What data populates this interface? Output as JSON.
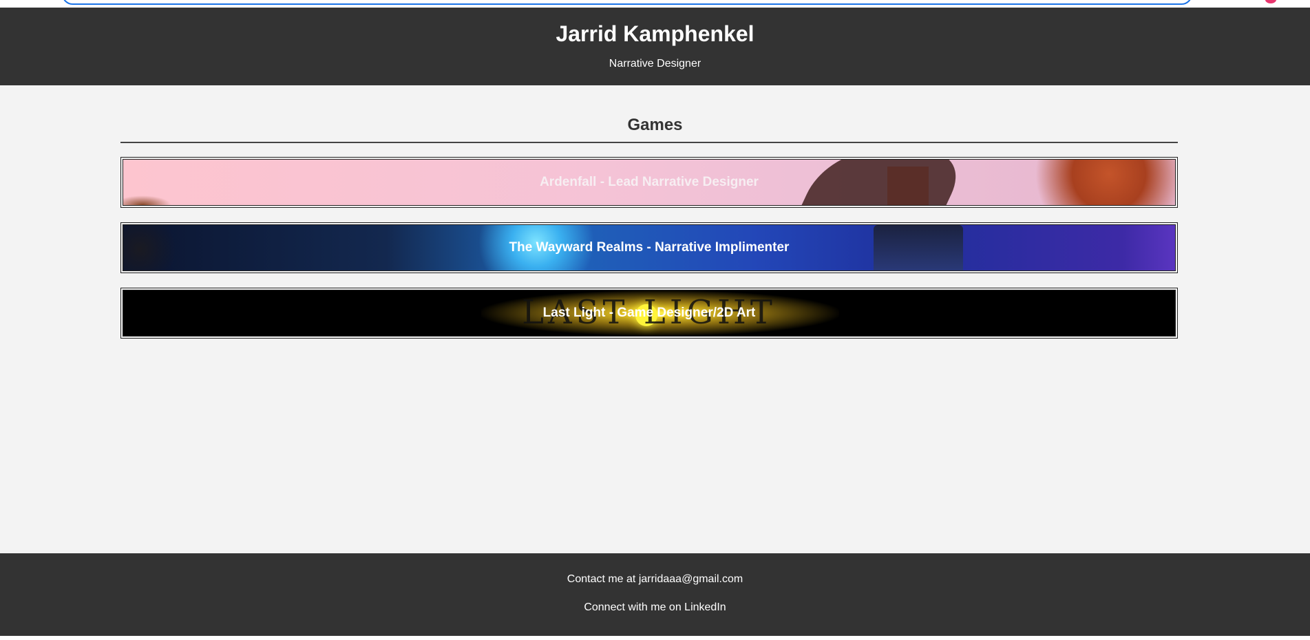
{
  "header": {
    "name": "Jarrid Kamphenkel",
    "role": "Narrative Designer"
  },
  "games_section": {
    "title": "Games",
    "items": [
      {
        "label": "Ardenfall - Lead Narrative Designer"
      },
      {
        "label": "The Wayward Realms - Narrative Implimenter"
      },
      {
        "label": "Last Light - Game Designer/2D Art",
        "logo_text": "LAST LIGHT"
      }
    ]
  },
  "footer": {
    "contact": "Contact me at jarridaaa@gmail.com",
    "linkedin_prefix": "Connect with me on ",
    "linkedin_link": "LinkedIn"
  },
  "colors": {
    "header_bg": "#333333",
    "page_bg": "#f3f3f3",
    "footer_bg": "#333333"
  }
}
